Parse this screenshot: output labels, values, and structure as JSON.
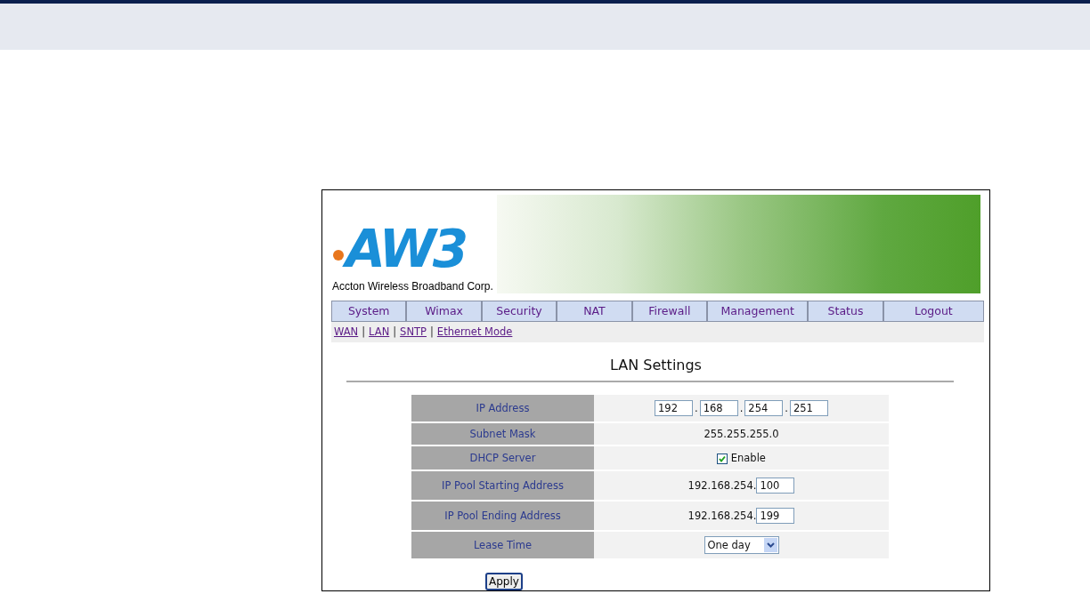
{
  "logo": {
    "mark": "AW3",
    "company": "Accton Wireless Broadband Corp."
  },
  "nav": [
    {
      "label": "System"
    },
    {
      "label": "Wimax"
    },
    {
      "label": "Security"
    },
    {
      "label": "NAT"
    },
    {
      "label": "Firewall"
    },
    {
      "label": "Management"
    },
    {
      "label": "Status"
    },
    {
      "label": "Logout"
    }
  ],
  "sub_links": [
    "WAN",
    "LAN",
    "SNTP",
    "Ethernet Mode"
  ],
  "link_separator": "|",
  "title": "LAN Settings",
  "rows": [
    {
      "kind": "ip",
      "label": "IP Address",
      "octets": [
        "192",
        "168",
        "254",
        "251"
      ],
      "separator": "."
    },
    {
      "kind": "text",
      "label": "Subnet Mask",
      "value": "255.255.255.0"
    },
    {
      "kind": "checkbox",
      "label": "DHCP Server",
      "checked": true,
      "text": "Enable"
    },
    {
      "kind": "prefix_input",
      "label": "IP Pool Starting Address",
      "prefix": "192.168.254.",
      "value": "100"
    },
    {
      "kind": "prefix_input",
      "label": "IP Pool Ending Address",
      "prefix": "192.168.254.",
      "value": "199"
    },
    {
      "kind": "select",
      "label": "Lease Time",
      "value": "One day"
    }
  ],
  "apply_button": "Apply"
}
